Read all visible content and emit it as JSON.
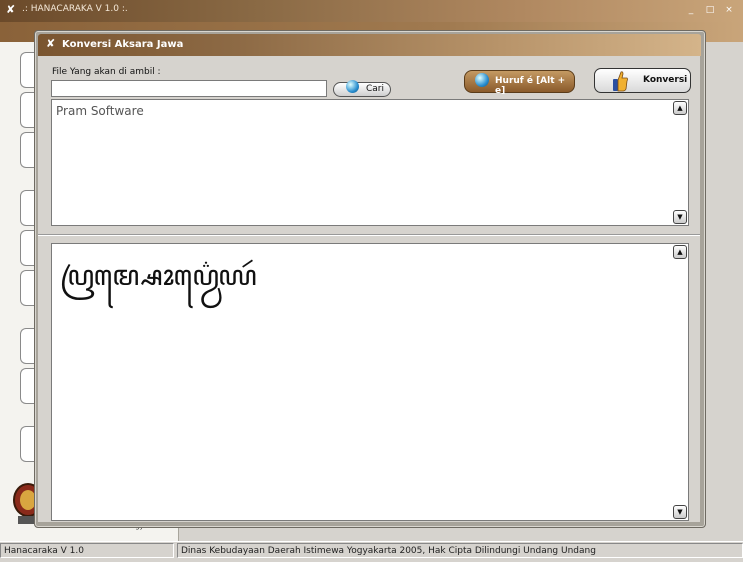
{
  "outer_window": {
    "title": ".: HANACARAKA V 1.0 :.",
    "controls": [
      "_",
      "□",
      "×"
    ],
    "footer_text": "Daerah Istimewa Yogyakarta"
  },
  "dialog": {
    "title": "Konversi Aksara Jawa",
    "file_label": "File Yang akan di ambil :",
    "file_value": "",
    "cari_label": "Cari",
    "huruf_label": "Huruf é [Alt + e]",
    "konversi_label": "Konversi",
    "source_text": "Pram Software",
    "output_text": "ꦥꦿꦩ꧀ꦱꦺꦴꦥ꦳꧀ꦮꦺꦪꦂ"
  },
  "status_bar": {
    "app": "Hanacaraka V 1.0",
    "info": "Dinas Kebudayaan Daerah Istimewa Yogyakarta 2005, Hak Cipta Dilindungi Undang Undang"
  },
  "colors": {
    "title_brown": "#7a5530",
    "accent_tan": "#c49a63"
  }
}
